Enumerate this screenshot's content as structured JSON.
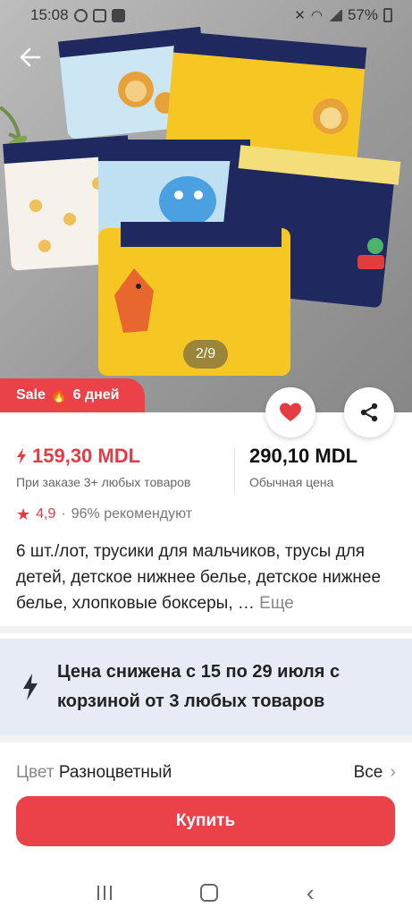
{
  "status_bar": {
    "time": "15:08",
    "battery": "57%"
  },
  "gallery": {
    "page_indicator": "2/9"
  },
  "sale_badge": {
    "label": "Sale",
    "fire": "🔥",
    "days": "6 дней"
  },
  "price": {
    "sale_price": "159,30 MDL",
    "sale_note": "При заказе 3+ любых товаров",
    "regular_price": "290,10 MDL",
    "regular_note": "Обычная цена"
  },
  "rating": {
    "score": "4,9",
    "separator": "·",
    "recommend": "96% рекомендуют"
  },
  "product": {
    "title": "6 шт./лот, трусики для мальчиков, трусы для детей, детское нижнее белье, детское нижнее белье, хлопковые боксеры, …",
    "more_label": "Еще"
  },
  "promo": {
    "text": "Цена снижена с 15 по 29 июля с корзиной от 3 любых товаров"
  },
  "color_option": {
    "label": "Цвет",
    "value": "Разноцветный",
    "all_label": "Все"
  },
  "buy_button": {
    "label": "Купить"
  },
  "colors": {
    "accent": "#ea4248",
    "price_red": "#e53b43",
    "promo_bg": "#e6ebf5",
    "underwear_yellow": "#f6c622",
    "underwear_navy": "#1f2960",
    "underwear_blue": "#bfe0f2"
  },
  "icons": [
    "back-arrow-icon",
    "heart-icon",
    "share-icon",
    "bolt-icon",
    "star-icon",
    "lightning-icon",
    "chevron-right-icon"
  ]
}
